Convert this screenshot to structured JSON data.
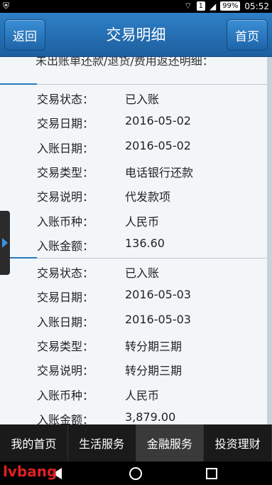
{
  "status_bar": {
    "badge": "1",
    "battery": "99%",
    "time": "05:52"
  },
  "header": {
    "back_label": "返回",
    "title": "交易明细",
    "home_label": "首页"
  },
  "banner_text": "未出账单还款/退货/费用返还明细：",
  "records": [
    {
      "fields": [
        {
          "label": "交易状态：",
          "value": "已入账"
        },
        {
          "label": "交易日期：",
          "value": "2016-05-02"
        },
        {
          "label": "入账日期：",
          "value": "2016-05-02"
        },
        {
          "label": "交易类型：",
          "value": "电话银行还款"
        },
        {
          "label": "交易说明：",
          "value": "代发款项"
        },
        {
          "label": "入账币种：",
          "value": "人民币"
        },
        {
          "label": "入账金额：",
          "value": "136.60"
        }
      ]
    },
    {
      "fields": [
        {
          "label": "交易状态：",
          "value": "已入账"
        },
        {
          "label": "交易日期：",
          "value": "2016-05-03"
        },
        {
          "label": "入账日期：",
          "value": "2016-05-03"
        },
        {
          "label": "交易类型：",
          "value": "转分期三期"
        },
        {
          "label": "交易说明：",
          "value": "转分期三期"
        },
        {
          "label": "入账币种：",
          "value": "人民币"
        },
        {
          "label": "入账金额：",
          "value": "3,879.00"
        }
      ]
    }
  ],
  "tabs": [
    {
      "label": "我的首页"
    },
    {
      "label": "生活服务"
    },
    {
      "label": "金融服务"
    },
    {
      "label": "投资理财"
    }
  ],
  "active_tab": 2,
  "watermark": "lvbang",
  "colors": {
    "header": "#2f80c8",
    "accent": "#2a7ac2",
    "tabbar": "#1a1a1a"
  }
}
